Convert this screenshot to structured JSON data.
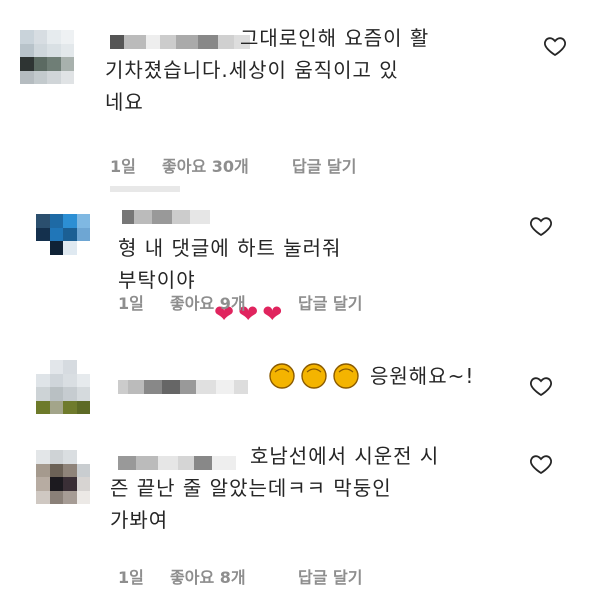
{
  "comments": [
    {
      "text": "그대로인해 요즘이 활\n기차졌습니다.세상이 움직이고 있\n네요",
      "time": "1일",
      "likes": "좋아요 30개",
      "reply": "답글 달기"
    },
    {
      "text": "형 내 댓글에 하트 눌러줘\n부탁이야",
      "emoji": "❤❤❤",
      "time": "1일",
      "likes": "좋아요 9개",
      "reply": "답글 달기"
    },
    {
      "text": "응원해요~!",
      "emoji_name": "clapping-hands-icon",
      "time": "",
      "likes": "",
      "reply": ""
    },
    {
      "text": "호남선에서 시운전 시\n즌 끝난 줄 알았는데ㅋㅋ 막둥인\n가봐여",
      "time": "1일",
      "likes": "좋아요 8개",
      "reply": "답글 달기"
    }
  ],
  "colors": {
    "text": "#262626",
    "meta": "#8e8e8e",
    "heart_emoji": "#e0245e",
    "clap_emoji": "#f4b400"
  }
}
